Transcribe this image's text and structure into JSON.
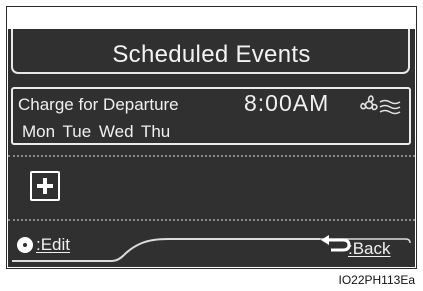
{
  "screen": {
    "title": "Scheduled Events",
    "event": {
      "name": "Charge for Departure",
      "time": "8:00AM",
      "days": "Mon Tue Wed Thu",
      "icon": "fan-icon"
    },
    "add_icon": "plus-icon",
    "footer": {
      "edit_label": ":Edit",
      "edit_icon": "knob-icon",
      "back_label": ":Back",
      "back_icon": "back-arrow-icon"
    }
  },
  "figure_code": "IO22PH113Ea",
  "colors": {
    "screen_bg": "#303030",
    "text": "#f0f0f0",
    "divider": "#8a8a8a"
  }
}
